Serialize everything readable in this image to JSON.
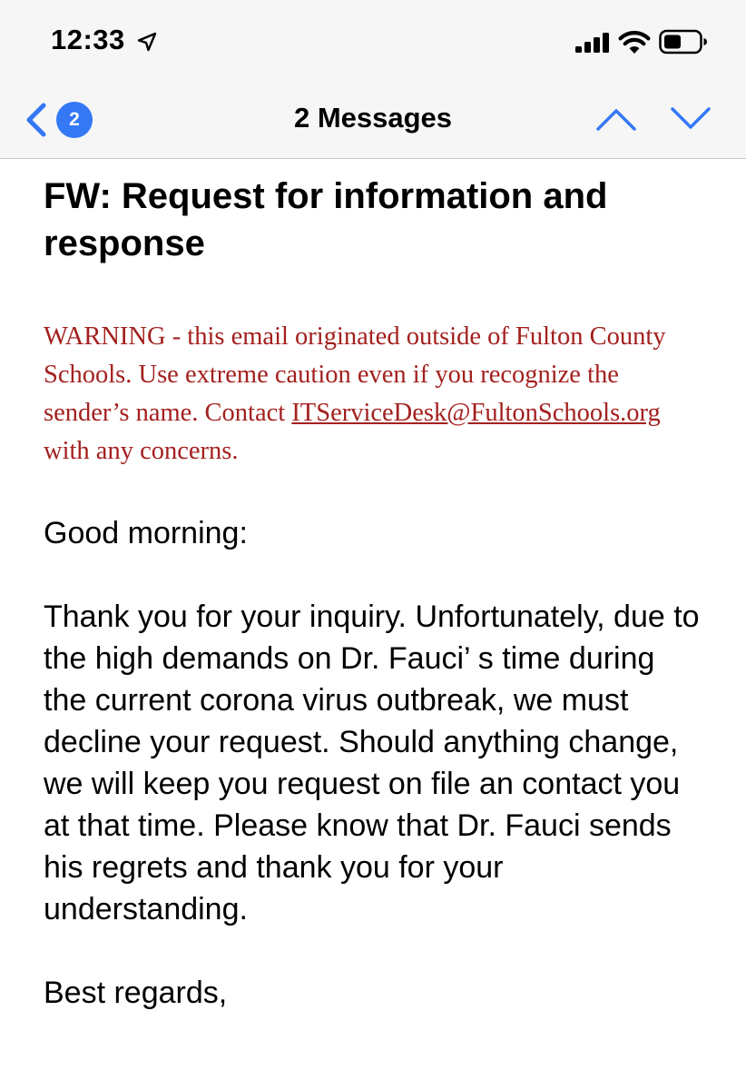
{
  "status_bar": {
    "time": "12:33",
    "icons": [
      "location-arrow-icon",
      "cellular-signal-icon",
      "wifi-icon",
      "battery-icon"
    ]
  },
  "nav": {
    "back_badge_count": "2",
    "title": "2 Messages",
    "icons": [
      "chevron-left-icon",
      "chevron-up-icon",
      "chevron-down-icon"
    ]
  },
  "email": {
    "subject": "FW:  Request for information and response",
    "warning": {
      "text_before_link": "WARNING - this email originated outside of Fulton County Schools. Use extreme caution even if you recognize the sender’s name. Contact ",
      "link": "ITServiceDesk@FultonSchools.org",
      "text_after_link": " with any concerns."
    },
    "greeting": "Good morning:",
    "body": "Thank you for your inquiry.  Unfortunately, due to the high demands on Dr. Fauci’ s time during the current corona virus outbreak, we must decline your request. Should anything change, we will keep you request on file an contact you at that time. Please know that Dr. Fauci sends his regrets and thank you for your understanding.",
    "signoff": "Best regards,"
  },
  "colors": {
    "accent": "#3478f6",
    "warning": "#a3201e",
    "bar_background": "#f6f6f6"
  }
}
